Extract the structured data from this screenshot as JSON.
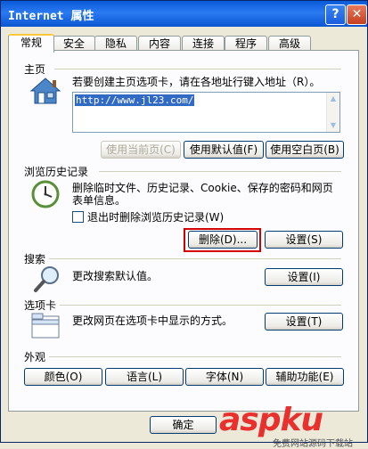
{
  "window": {
    "title": "Internet 属性"
  },
  "titlebar_buttons": {
    "help": "?",
    "close": "✕"
  },
  "tabs": [
    "常规",
    "安全",
    "隐私",
    "内容",
    "连接",
    "程序",
    "高级"
  ],
  "home": {
    "section": "主页",
    "description": "若要创建主页选项卡，请在各地址行键入地址（R）。",
    "url": "http://www.jl23.com/",
    "buttons": [
      "使用当前页(C)",
      "使用默认值(F)",
      "使用空白页(B)"
    ]
  },
  "history": {
    "section": "浏览历史记录",
    "description_line1": "删除临时文件、历史记录、Cookie、保存的密码和网页",
    "description_line2": "表单信息。",
    "checkbox_label": "退出时删除浏览历史记录(W)",
    "delete_button": "删除(D)...",
    "settings_button": "设置(S)"
  },
  "search": {
    "section": "搜索",
    "description": "更改搜索默认值。",
    "settings_button": "设置(I)"
  },
  "tabs_section": {
    "section": "选项卡",
    "description": "更改网页在选项卡中显示的方式。",
    "settings_button": "设置(T)"
  },
  "appearance": {
    "section": "外观",
    "buttons": [
      "颜色(O)",
      "语言(L)",
      "字体(N)",
      "辅助功能(E)"
    ]
  },
  "footer": {
    "ok": "确定"
  },
  "watermark": {
    "brand": "aspku",
    "sub": "免费网站源码下载站"
  }
}
